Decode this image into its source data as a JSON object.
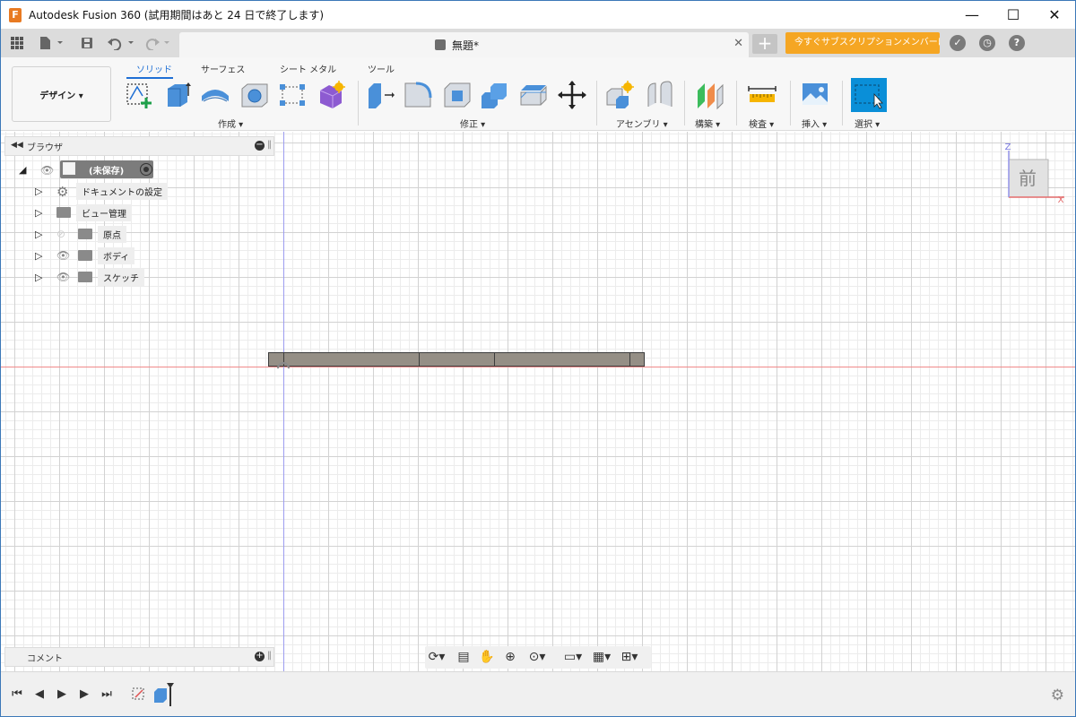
{
  "window": {
    "app_icon_letter": "F",
    "title": "Autodesk Fusion 360 (試用期間はあと 24 日で終了します)",
    "minimize": "—",
    "maximize": "☐",
    "close": "✕"
  },
  "tabbar": {
    "doc_title": "無題*",
    "close_tab": "✕",
    "new_tab": "+",
    "subscribe_label": "今すぐサブスクリプションメンバーに..."
  },
  "ribbon": {
    "workspace": "デザイン ▾",
    "tabs": [
      "ソリッド",
      "サーフェス",
      "シート メタル",
      "ツール"
    ],
    "active_tab": "ソリッド",
    "groups": [
      "作成 ▾",
      "修正 ▾",
      "アセンブリ ▾",
      "構築 ▾",
      "検査 ▾",
      "挿入 ▾",
      "選択 ▾"
    ]
  },
  "browser": {
    "title": "ブラウザ",
    "root": "(未保存)",
    "nodes": [
      "ドキュメントの設定",
      "ビュー管理",
      "原点",
      "ボディ",
      "スケッチ"
    ]
  },
  "comments": {
    "title": "コメント"
  },
  "viewcube": {
    "face": "前",
    "z_axis": "Z",
    "x_axis": "X"
  },
  "colors": {
    "accent": "#1f6fd4",
    "subscribe": "#f5a623",
    "body_fill": "#958f86",
    "x_axis": "#f08a8a",
    "z_axis": "#9d9df0"
  }
}
